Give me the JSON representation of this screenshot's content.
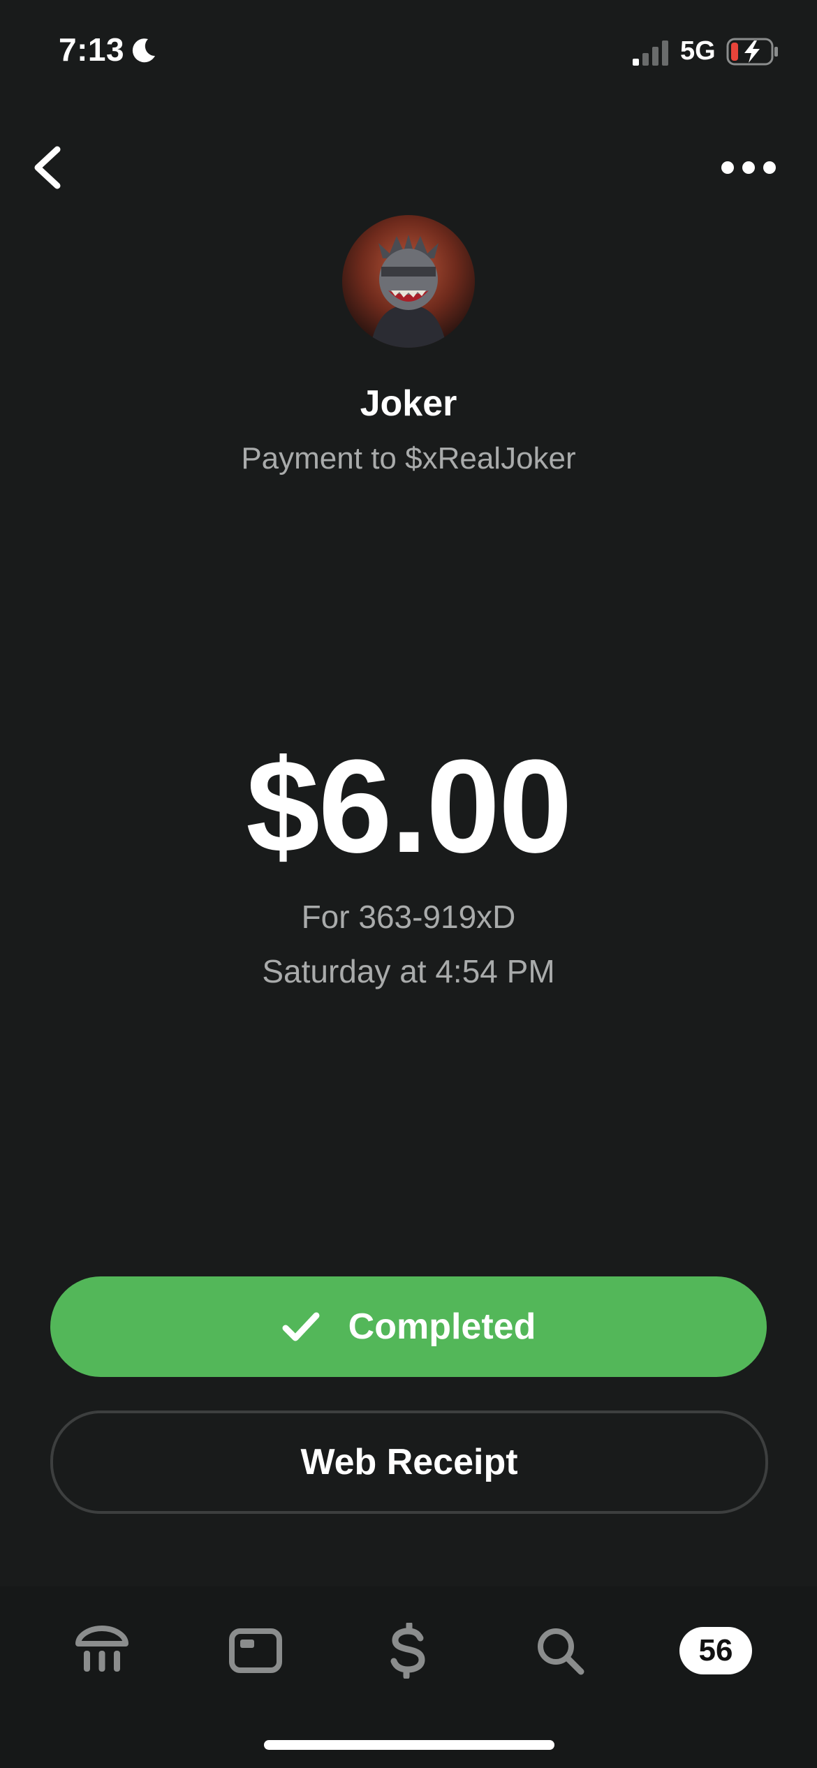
{
  "status_bar": {
    "time": "7:13",
    "network": "5G",
    "icons": [
      "moon-icon",
      "signal-icon",
      "battery-charging-icon"
    ]
  },
  "nav": {
    "back_icon": "chevron-left-icon",
    "more_icon": "ellipsis-icon"
  },
  "recipient": {
    "name": "Joker",
    "subtitle": "Payment to $xRealJoker"
  },
  "payment": {
    "amount": "$6.00",
    "note": "For 363-919xD",
    "date": "Saturday at 4:54 PM"
  },
  "actions": {
    "completed_label": "Completed",
    "completed_icon": "check-icon",
    "receipt_label": "Web Receipt"
  },
  "tab_bar": {
    "tabs": [
      {
        "icon": "bank-icon"
      },
      {
        "icon": "card-icon"
      },
      {
        "icon": "dollar-icon"
      },
      {
        "icon": "search-icon"
      },
      {
        "icon": "activity-badge",
        "badge": "56"
      }
    ]
  },
  "colors": {
    "background": "#191b1b",
    "accent_green": "#53b759",
    "secondary_text": "#a9abab",
    "battery_low": "#e8443a"
  }
}
